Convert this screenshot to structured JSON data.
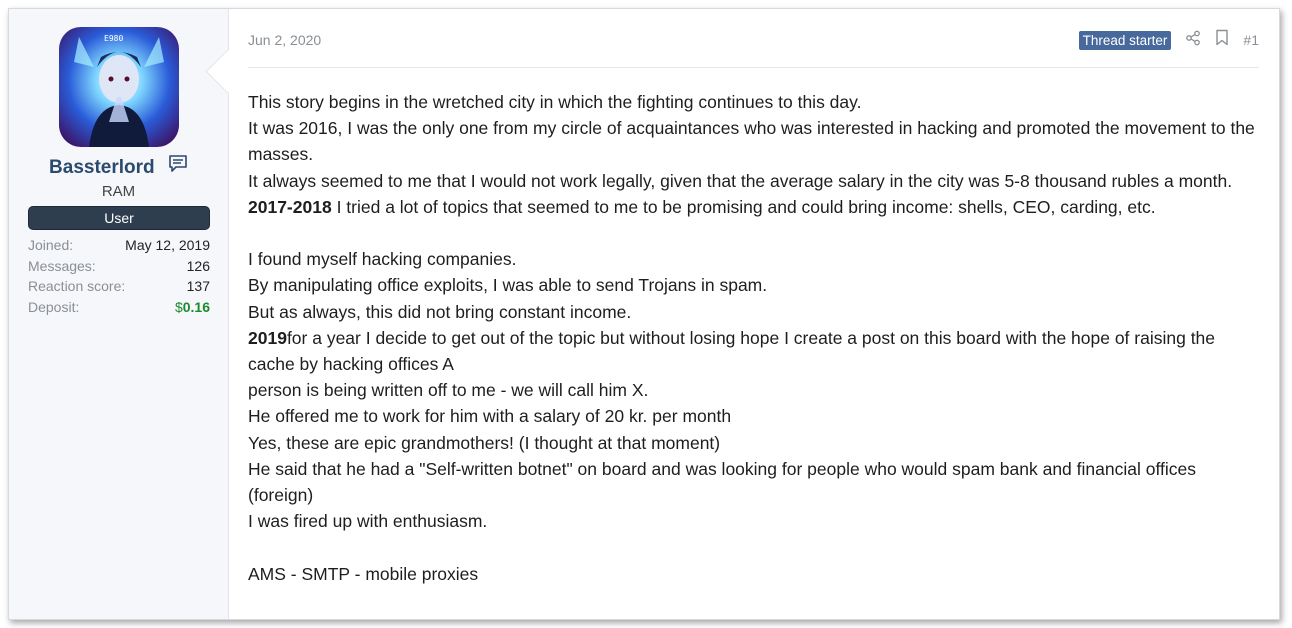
{
  "user": {
    "name": "Bassterlord",
    "title": "RAM",
    "banner": "User",
    "stats": [
      {
        "label": "Joined:",
        "value": "May 12, 2019"
      },
      {
        "label": "Messages:",
        "value": "126"
      },
      {
        "label": "Reaction score:",
        "value": "137"
      }
    ],
    "deposit": {
      "label": "Deposit:",
      "currency": "$",
      "amount": "0.16"
    }
  },
  "post": {
    "date": "Jun 2, 2020",
    "badge": "Thread starter",
    "number": "#1",
    "b1_l1": "This story begins in the wretched city in which the fighting continues to this day.",
    "b1_l2": "It was 2016, I was the only one from my circle of acquaintances who was interested in hacking and promoted the movement to the masses.",
    "b1_l3": "It always seemed to me that I would not work legally, given that the average salary in the city was 5-8 thousand rubles a month.",
    "b1_l4_bold": "2017-2018",
    "b1_l4": " I tried a lot of topics that seemed to me to be promising and could bring income: shells, CEO, carding, etc.",
    "b2_l1": "I found myself hacking companies.",
    "b2_l2": "By manipulating office exploits, I was able to send Trojans in spam.",
    "b2_l3": "But as always, this did not bring constant income.",
    "b2_l4_bold": "2019",
    "b2_l4": "for a year I decide to get out of the topic but without losing hope I create a post on this board with the hope of raising the cache by hacking offices A",
    "b2_l5": "person is being written off to me - we will call him X.",
    "b2_l6": "He offered me to work for him with a salary of 20 kr. per month",
    "b2_l7": "Yes, these are epic grandmothers! (I thought at that moment)",
    "b2_l8": "He said that he had a \"Self-written botnet\" on board and was looking for people who would spam bank and financial offices (foreign)",
    "b2_l9": "I was fired up with enthusiasm.",
    "b3_l1": "AMS - SMTP - mobile proxies"
  }
}
